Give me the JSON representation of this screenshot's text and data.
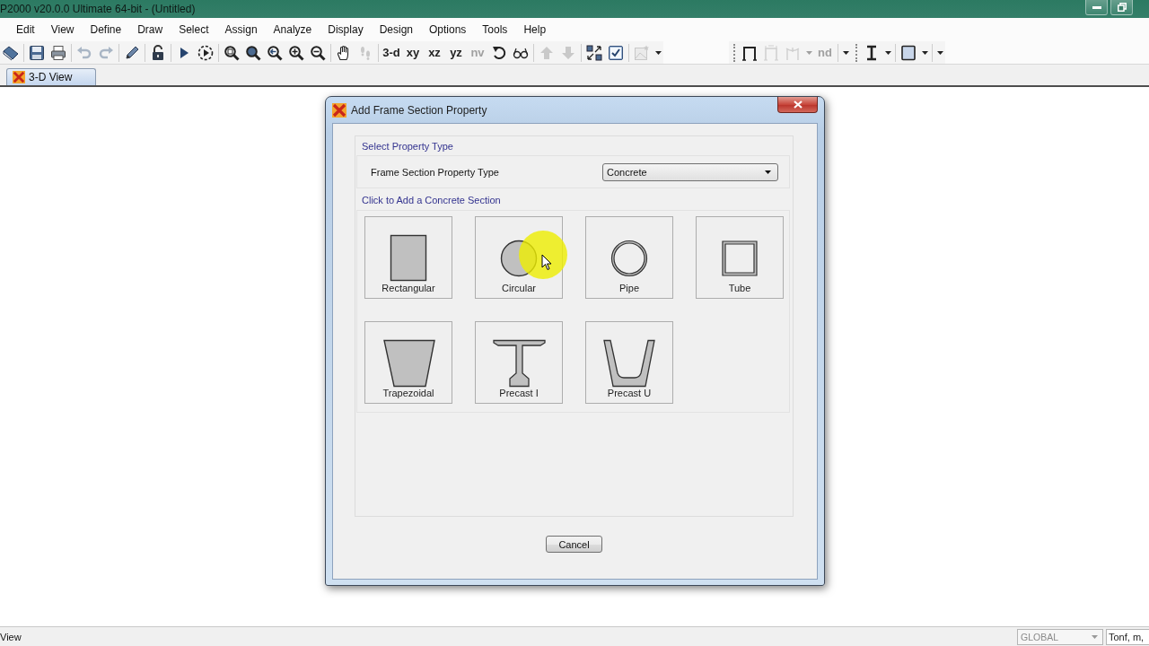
{
  "window": {
    "title": "P2000 v20.0.0 Ultimate 64-bit - (Untitled)"
  },
  "menu": [
    "Edit",
    "View",
    "Define",
    "Draw",
    "Select",
    "Assign",
    "Analyze",
    "Display",
    "Design",
    "Options",
    "Tools",
    "Help"
  ],
  "toolbars": [
    [
      [
        {
          "kind": "icon",
          "disabled": false
        }
      ],
      [
        {
          "kind": "icon",
          "disabled": false
        },
        {
          "kind": "icon",
          "disabled": false
        }
      ],
      [
        {
          "kind": "icon",
          "disabled": true
        },
        {
          "kind": "icon",
          "disabled": true
        }
      ],
      [
        {
          "kind": "icon",
          "disabled": false
        }
      ],
      [
        {
          "kind": "icon",
          "disabled": false
        }
      ],
      [
        {
          "kind": "icon",
          "disabled": false
        },
        {
          "kind": "icon",
          "disabled": false
        }
      ],
      [
        {
          "kind": "icon",
          "disabled": false
        },
        {
          "kind": "icon",
          "disabled": false
        },
        {
          "kind": "icon",
          "disabled": false
        },
        {
          "kind": "icon",
          "disabled": false
        },
        {
          "kind": "icon",
          "disabled": false
        }
      ],
      [
        {
          "kind": "icon",
          "disabled": false
        },
        {
          "kind": "icon",
          "disabled": true
        }
      ],
      [
        {
          "kind": "text",
          "label": "3-d",
          "disabled": false
        },
        {
          "kind": "text",
          "label": "xy",
          "disabled": false
        },
        {
          "kind": "text",
          "label": "xz",
          "disabled": false
        },
        {
          "kind": "text",
          "label": "yz",
          "disabled": false
        },
        {
          "kind": "text",
          "label": "nv",
          "disabled": true
        },
        {
          "kind": "icon",
          "disabled": false
        },
        {
          "kind": "icon",
          "disabled": false
        }
      ],
      [
        {
          "kind": "icon",
          "disabled": true
        },
        {
          "kind": "icon",
          "disabled": true
        }
      ],
      [
        {
          "kind": "icon",
          "disabled": false
        },
        {
          "kind": "icon",
          "disabled": false
        }
      ],
      [
        {
          "kind": "icon",
          "disabled": true
        },
        {
          "kind": "caret",
          "disabled": false
        }
      ]
    ],
    [
      [
        {
          "kind": "icon",
          "disabled": false
        },
        {
          "kind": "icon",
          "disabled": true
        },
        {
          "kind": "icon",
          "disabled": true
        },
        {
          "kind": "caret",
          "disabled": true
        },
        {
          "kind": "text",
          "label": "nd",
          "disabled": true
        }
      ],
      [
        {
          "kind": "caret",
          "disabled": false
        }
      ]
    ],
    [
      [
        {
          "kind": "icon",
          "disabled": false
        },
        {
          "kind": "caret",
          "disabled": false
        }
      ],
      [
        {
          "kind": "icon",
          "disabled": false
        },
        {
          "kind": "caret",
          "disabled": false
        }
      ],
      [
        {
          "kind": "caret",
          "disabled": false
        }
      ]
    ]
  ],
  "tabs": [
    {
      "label": "3-D View",
      "selected": true
    }
  ],
  "dialog": {
    "title": "Add Frame Section Property",
    "property_group": {
      "heading": "Select Property Type",
      "label": "Frame Section Property Type",
      "dropdown": {
        "value": "Concrete"
      }
    },
    "section_group": {
      "heading": "Click to Add a Concrete Section",
      "sections": [
        {
          "label": "Rectangular"
        },
        {
          "label": "Circular"
        },
        {
          "label": "Pipe"
        },
        {
          "label": "Tube"
        },
        {
          "label": "Trapezoidal"
        },
        {
          "label": "Precast I"
        },
        {
          "label": "Precast U"
        }
      ]
    },
    "buttons": [
      {
        "label": "Cancel"
      }
    ]
  },
  "status_bar": {
    "text": "View",
    "coordinate_system": {
      "value": "GLOBAL",
      "disabled": true
    },
    "units": "Tonf, m,"
  }
}
